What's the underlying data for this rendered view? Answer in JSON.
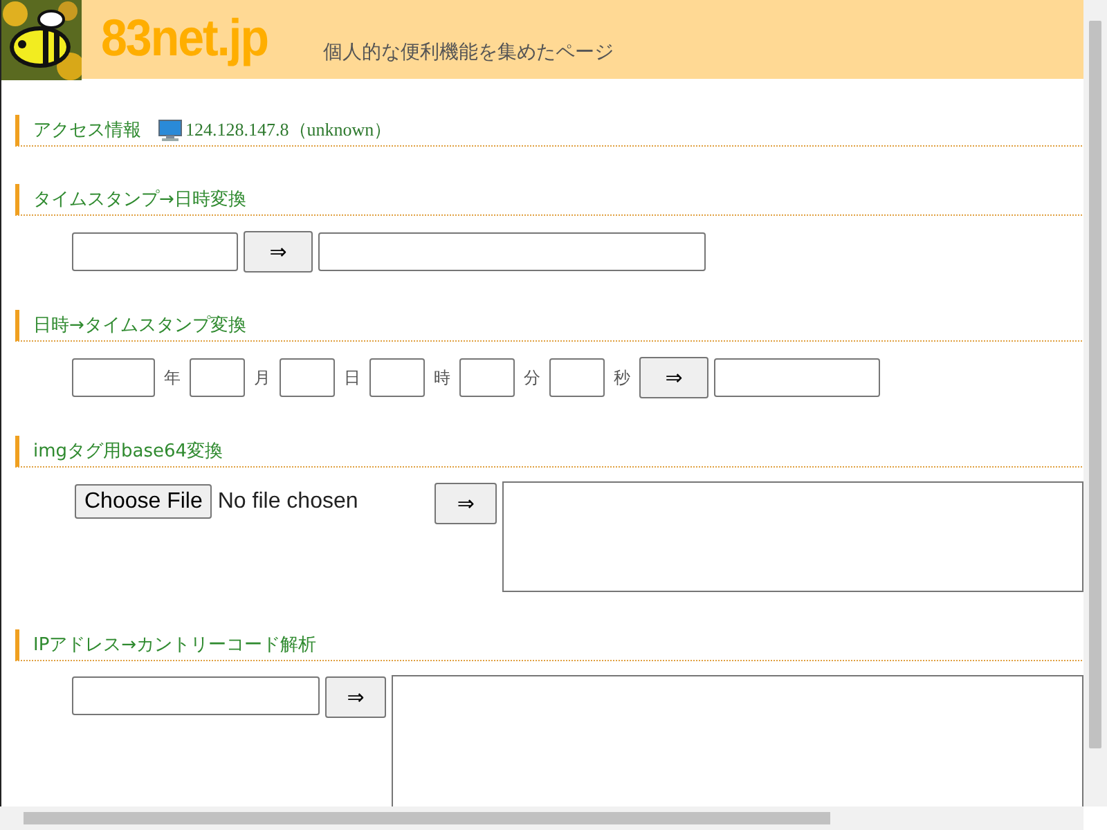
{
  "header": {
    "logo": "83net.jp",
    "tagline": "個人的な便利機能を集めたページ"
  },
  "sections": [
    {
      "kind": "access",
      "title": "アクセス情報",
      "ip": "124.128.147.8（unknown）"
    },
    {
      "kind": "timestamp",
      "title": "タイムスタンプ→日時変換",
      "button": "⇒"
    },
    {
      "kind": "datetime",
      "title": "日時→タイムスタンプ変換",
      "units": [
        "年",
        "月",
        "日",
        "時",
        "分",
        "秒"
      ],
      "button": "⇒"
    },
    {
      "kind": "file",
      "title": "imgタグ用base64変換",
      "file_button": "Choose File",
      "file_status": "No file chosen",
      "button": "⇒"
    },
    {
      "kind": "ip",
      "title": "IPアドレス→カントリーコード解析",
      "button": "⇒"
    }
  ]
}
